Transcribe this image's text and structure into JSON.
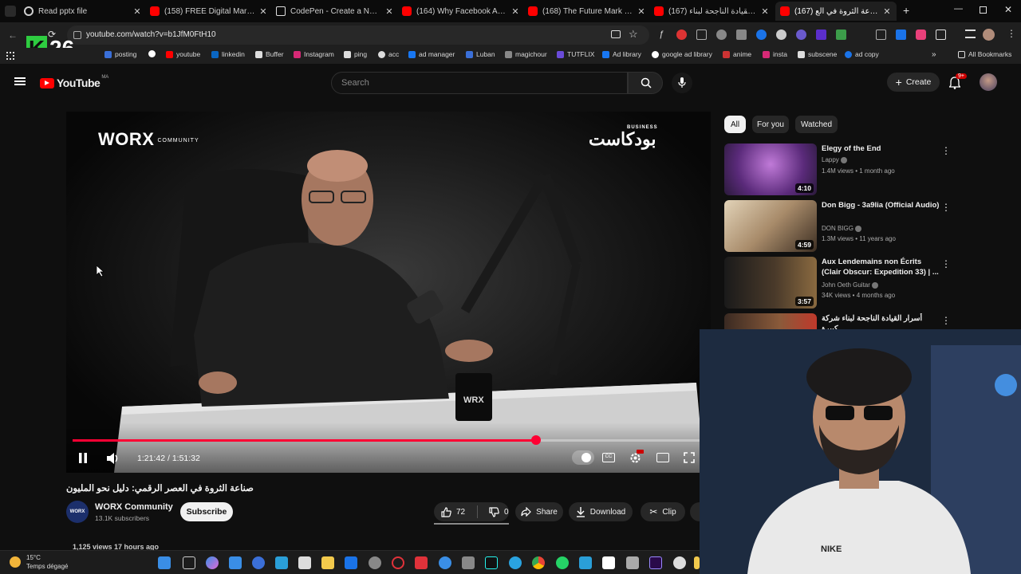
{
  "browser": {
    "tabs": [
      {
        "title": "Read pptx file",
        "icon": "gear-icon"
      },
      {
        "title": "(158) FREE Digital Marketing",
        "icon": "youtube-icon"
      },
      {
        "title": "CodePen - Create a New Pen",
        "icon": "codepen-icon"
      },
      {
        "title": "(164) Why Facebook Ads Are",
        "icon": "youtube-icon"
      },
      {
        "title": "(168) The Future Mark Zucker",
        "icon": "youtube-icon"
      },
      {
        "title": "(167) أسرار القيادة الناجحة لبناء",
        "icon": "youtube-icon"
      },
      {
        "title": "(167) صناعة الثروة في الع",
        "icon": "youtube-icon",
        "active": true
      }
    ],
    "url": "youtube.com/watch?v=b1JfM0FtH10",
    "overlay_logo": "26",
    "bookmarks": [
      "posting",
      "youtube",
      "linkedin",
      "Buffer",
      "Instagram",
      "ping",
      "acc",
      "ad manager",
      "Luban",
      "magichour",
      "TUTFLIX",
      "Ad library",
      "google ad library",
      "anime",
      "insta",
      "subscene",
      "ad copy"
    ],
    "all_bookmarks": "All Bookmarks"
  },
  "youtube": {
    "logo": "YouTube",
    "region": "MA",
    "search_placeholder": "Search",
    "create_label": "Create",
    "notif_badge": "9+"
  },
  "player": {
    "channel_watermark": "WORX",
    "channel_watermark_sub": "COMMUNITY",
    "podcast_logo": "بودكاست",
    "podcast_logo_sub": "BUSINESS",
    "current_time": "1:21:42",
    "duration": "1:51:32",
    "progress": 0.733
  },
  "video": {
    "title": "صناعة الثروة في العصر الرقمي: دليل نحو المليون",
    "channel": "WORX Community",
    "avatar_text": "WORX",
    "subscribers": "13.1K subscribers",
    "subscribe_label": "Subscribe",
    "likes": "72",
    "dislikes": "0",
    "share_label": "Share",
    "download_label": "Download",
    "clip_label": "Clip",
    "views_line": "1,125 views  17 hours ago"
  },
  "chips": [
    "All",
    "For you",
    "Watched"
  ],
  "recommendations": [
    {
      "title": "Elegy of the End",
      "channel": "Lappy",
      "meta": "1.4M views • 1 month ago",
      "duration": "4:10",
      "color": "#6b3a8c"
    },
    {
      "title": "Don Bigg - 3a9lia (Official Audio)",
      "channel": "DON BIGG",
      "meta": "1.3M views • 11 years ago",
      "duration": "4:59",
      "color": "#a88b6a"
    },
    {
      "title": "Aux Lendemains non Écrits (Clair Obscur: Expedition 33) | ...",
      "channel": "John Oeth Guitar",
      "meta": "34K views • 4 months ago",
      "duration": "3:57",
      "color": "#3a3530"
    },
    {
      "title": "أسرار القيادة الناجحة لبناء شركة كبيرة",
      "channel": "",
      "meta": "",
      "duration": "",
      "color": "#5a4030"
    }
  ],
  "taskbar": {
    "temperature": "15°C",
    "weather": "Temps dégagé"
  },
  "colors": {
    "youtube_red": "#ff0000",
    "progress_red": "#ff0033",
    "background": "#0f0f0f"
  }
}
